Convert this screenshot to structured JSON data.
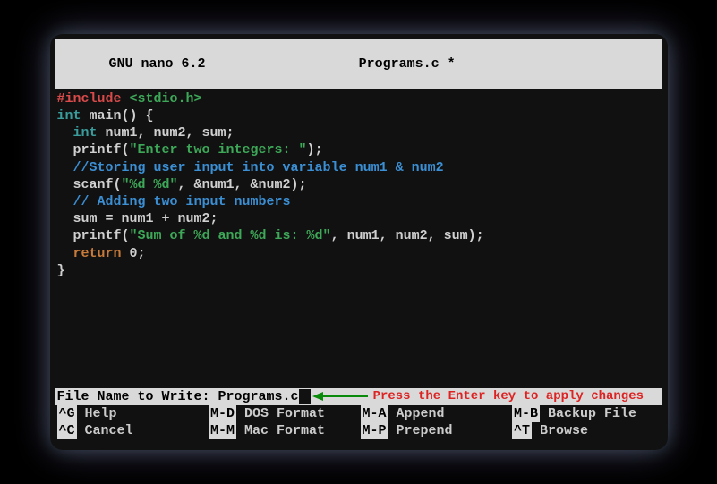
{
  "title_bar": {
    "left": "  GNU nano 6.2",
    "center": "Programs.c *"
  },
  "code": {
    "l1_include": "#include",
    "l1_header": " <stdio.h>",
    "l2_int": "int",
    "l2_rest": " main() {",
    "l3": "",
    "l4_pad": "  ",
    "l4_int": "int",
    "l4_rest": " num1, num2, sum;",
    "l5": "",
    "l6_pad": "  printf(",
    "l6_str": "\"Enter two integers: \"",
    "l6_end": ");",
    "l7_pad": "  ",
    "l7_comment": "//Storing user input into variable num1 & num2",
    "l8_pad": "  scanf(",
    "l8_str": "\"%d %d\"",
    "l8_end": ", &num1, &num2);",
    "l9": "",
    "l10_pad": "  ",
    "l10_comment": "// Adding two input numbers",
    "l11": "  sum = num1 + num2;",
    "l12": "",
    "l13_pad": "  printf(",
    "l13_str": "\"Sum of %d and %d is: %d\"",
    "l13_end": ", num1, num2, sum);",
    "l14_pad": "  ",
    "l14_return": "return",
    "l14_end": " 0;",
    "l15": "}"
  },
  "prompt": {
    "label": "File Name to Write: ",
    "value": "Programs.c",
    "annotation": "Press the Enter key to apply changes"
  },
  "shortcuts": {
    "r1c1_key": "^G",
    "r1c1_label": " Help",
    "r1c2_key": "M-D",
    "r1c2_label": " DOS Format",
    "r1c3_key": "M-A",
    "r1c3_label": " Append",
    "r1c4_key": "M-B",
    "r1c4_label": " Backup File",
    "r2c1_key": "^C",
    "r2c1_label": " Cancel",
    "r2c2_key": "M-M",
    "r2c2_label": " Mac Format",
    "r2c3_key": "M-P",
    "r2c3_label": " Prepend",
    "r2c4_key": "^T",
    "r2c4_label": " Browse"
  }
}
